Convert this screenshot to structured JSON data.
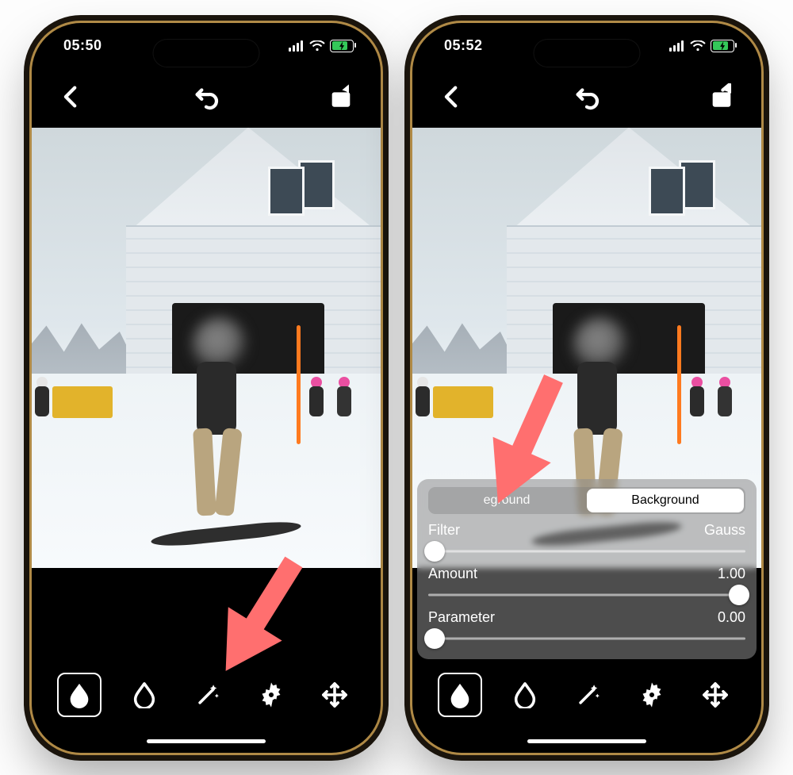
{
  "left": {
    "status": {
      "time": "05:50"
    },
    "toolbar": {
      "active_tool": "blur-solid",
      "tools": [
        "blur-solid",
        "blur-outline",
        "magic-wand",
        "settings",
        "move"
      ]
    }
  },
  "right": {
    "status": {
      "time": "05:52"
    },
    "toolbar": {
      "active_tool": "blur-solid",
      "tools": [
        "blur-solid",
        "blur-outline",
        "magic-wand",
        "settings",
        "move"
      ]
    },
    "settings": {
      "segments": {
        "foreground_partial": "eground",
        "background": "Background",
        "active": "background"
      },
      "rows": {
        "filter": {
          "label": "Filter",
          "value": "Gauss",
          "slider_pos": 0.02
        },
        "amount": {
          "label": "Amount",
          "value": "1.00",
          "slider_pos": 0.98
        },
        "parameter": {
          "label": "Parameter",
          "value": "0.00",
          "slider_pos": 0.02
        }
      }
    }
  },
  "colors": {
    "arrow": "#ff6f6f",
    "accent_green": "#34c759"
  }
}
